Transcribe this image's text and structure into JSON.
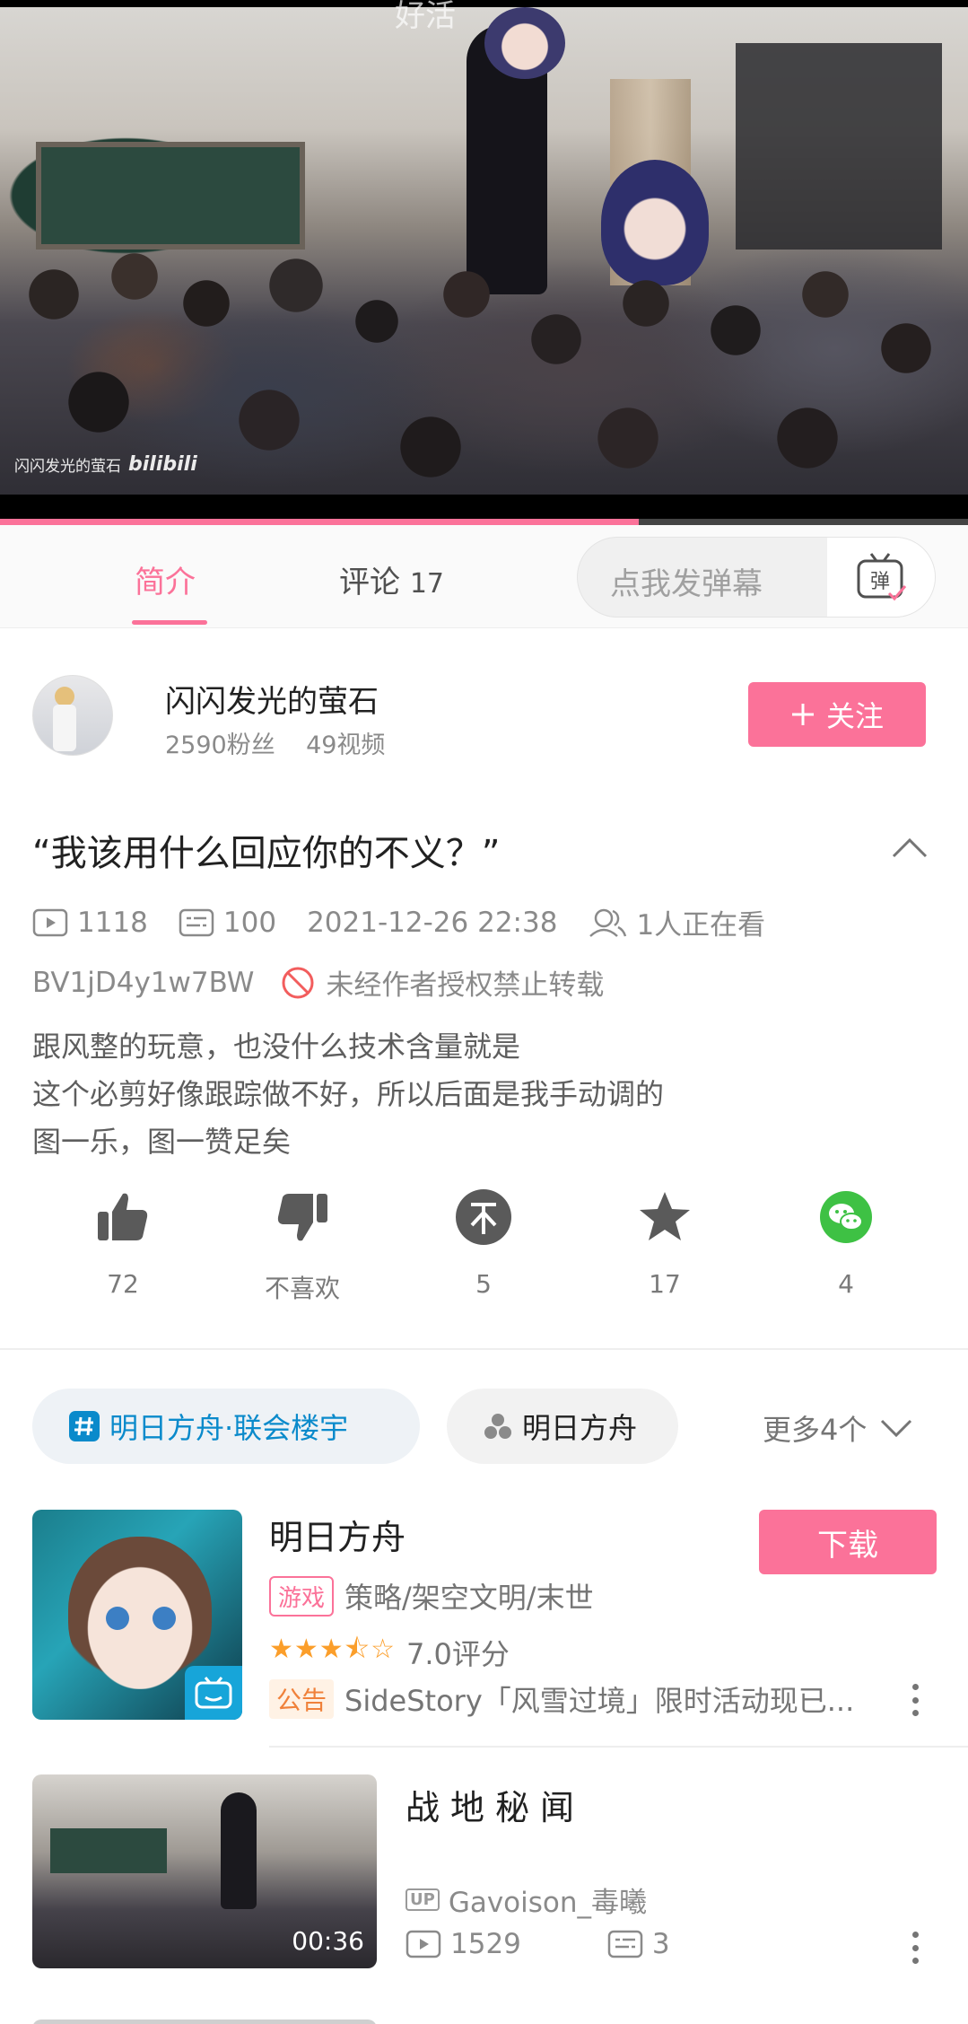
{
  "player": {
    "top_text": "好活",
    "watermark": "闪闪发光的萤石",
    "watermark_logo": "bilibili",
    "progress_percent": 66
  },
  "tabs": {
    "intro": "简介",
    "comments_label": "评论",
    "comments_count": "17",
    "danmaku_placeholder": "点我发弹幕",
    "danmaku_button_icon": "弹"
  },
  "uploader": {
    "name": "闪闪发光的萤石",
    "fans": "2590粉丝",
    "videos": "49视频",
    "follow_label": "关注"
  },
  "video": {
    "title": "“我该用什么回应你的不义？”",
    "views": "1118",
    "danmaku": "100",
    "date": "2021-12-26 22:38",
    "watching": "1人正在看",
    "bvid": "BV1jD4y1w7BW",
    "repost_warning": "未经作者授权禁止转载",
    "desc": [
      "跟风整的玩意，也没什么技术含量就是",
      "这个必剪好像跟踪做不好，所以后面是我手动调的",
      "图一乐，图一赞足矣"
    ]
  },
  "actions": {
    "like": "72",
    "dislike": "不喜欢",
    "coin": "5",
    "favorite": "17",
    "share": "4"
  },
  "tags": {
    "tag1": "明日方舟·联会楼宇",
    "tag2": "明日方舟",
    "more": "更多4个"
  },
  "game": {
    "name": "明日方舟",
    "download": "下载",
    "category_badge": "游戏",
    "category": "策略/架空文明/末世",
    "stars": "★★★⯪☆",
    "rating": "7.0评分",
    "notice_badge": "公告",
    "notice": "SideStory「风雪过境」限时活动现已..."
  },
  "related": {
    "title": "战地秘闻",
    "duration": "00:36",
    "up_badge": "UP",
    "up_name": "Gavoison_毒曦",
    "views": "1529",
    "danmaku": "3"
  },
  "colors": {
    "accent": "#fb7299",
    "tag_blue": "#0a8acb",
    "star": "#fb9e2a"
  }
}
